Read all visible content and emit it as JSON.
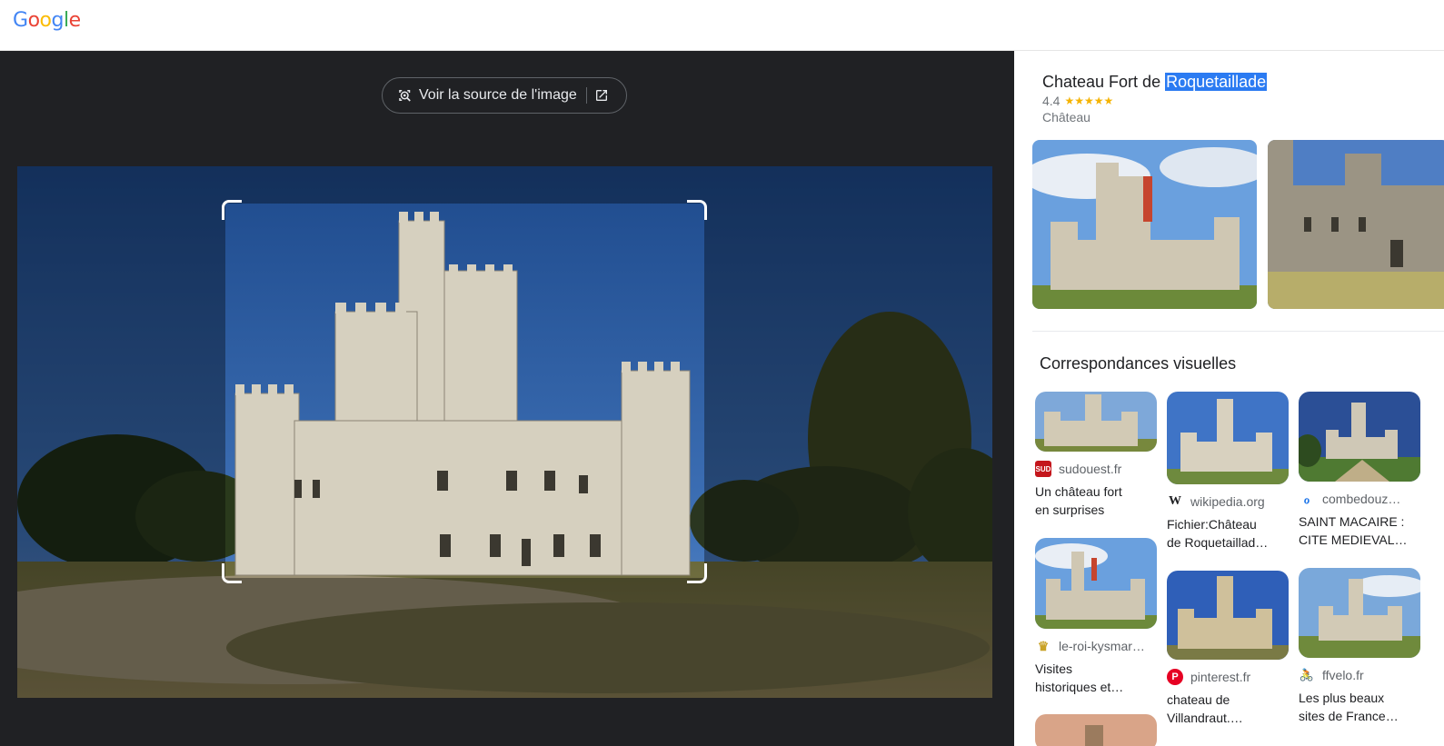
{
  "header": {
    "logo": [
      "G",
      "o",
      "o",
      "g",
      "l",
      "e"
    ],
    "logo_colors": [
      "#4285F4",
      "#EA4335",
      "#FBBC05",
      "#4285F4",
      "#34A853",
      "#EA4335"
    ]
  },
  "viewer": {
    "source_button_label": "Voir la source de l'image",
    "icons": [
      "lens-icon",
      "open-in-new-icon"
    ]
  },
  "panel": {
    "title_prefix": "Chateau Fort de ",
    "title_highlight": "Roquetaillade",
    "rating": "4.4",
    "stars": "★★★★★",
    "type": "Château",
    "visual_matches_title": "Correspondances visuelles",
    "matches": [
      {
        "source": "sudouest.fr",
        "title_1": "Un château fort",
        "title_2": "en surprises",
        "favicon_color": "#c4161c",
        "favicon_text": "SUD OUEST"
      },
      {
        "source": "wikipedia.org",
        "title_1": "Fichier:Château",
        "title_2": "de Roquetaillad…",
        "favicon_color": "#ffffff",
        "favicon_text": "W"
      },
      {
        "source": "combedouz…",
        "title_1": "SAINT MACAIRE :",
        "title_2": "CITE MEDIEVAL…",
        "favicon_color": "#ffffff",
        "favicon_text": ""
      },
      {
        "source": "le-roi-kysmar…",
        "title_1": "Visites",
        "title_2": "historiques et…",
        "favicon_color": "#ffffff",
        "favicon_text": ""
      },
      {
        "source": "pinterest.fr",
        "title_1": "chateau de",
        "title_2": "Villandraut.…",
        "favicon_color": "#e60023",
        "favicon_text": "P"
      },
      {
        "source": "ffvelo.fr",
        "title_1": "Les plus beaux",
        "title_2": "sites de France…",
        "favicon_color": "#ffffff",
        "favicon_text": ""
      }
    ]
  },
  "colors": {
    "dark_bg": "#202124",
    "accent": "#2b7bf2",
    "star": "#f5b301"
  }
}
